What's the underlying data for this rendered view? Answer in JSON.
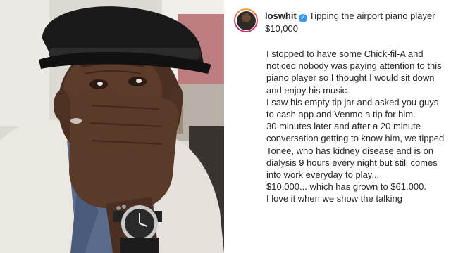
{
  "post": {
    "username": "loswhit",
    "verified_icon": "verified-badge-icon",
    "title": "Tipping the airport piano player $10,000",
    "paragraphs": [
      "I stopped to have some Chick-fil-A and noticed nobody was paying attention to this piano player so I thought I would sit down and enjoy his music.",
      "I saw his empty tip jar and asked you guys to cash app and Venmo a tip for him.",
      "30 minutes later and after a 20 minute conversation getting to know him, we tipped Tonee, who has kidney disease and is on dialysis 9 hours every night but still comes into work everyday to play...",
      "$10,000... which has grown to $61,000.",
      "I love it when we show the talking"
    ]
  },
  "colors": {
    "text": "#262626",
    "verified": "#3897f0",
    "hat": "#1a1a1a",
    "jacket": "#e8e4de"
  }
}
